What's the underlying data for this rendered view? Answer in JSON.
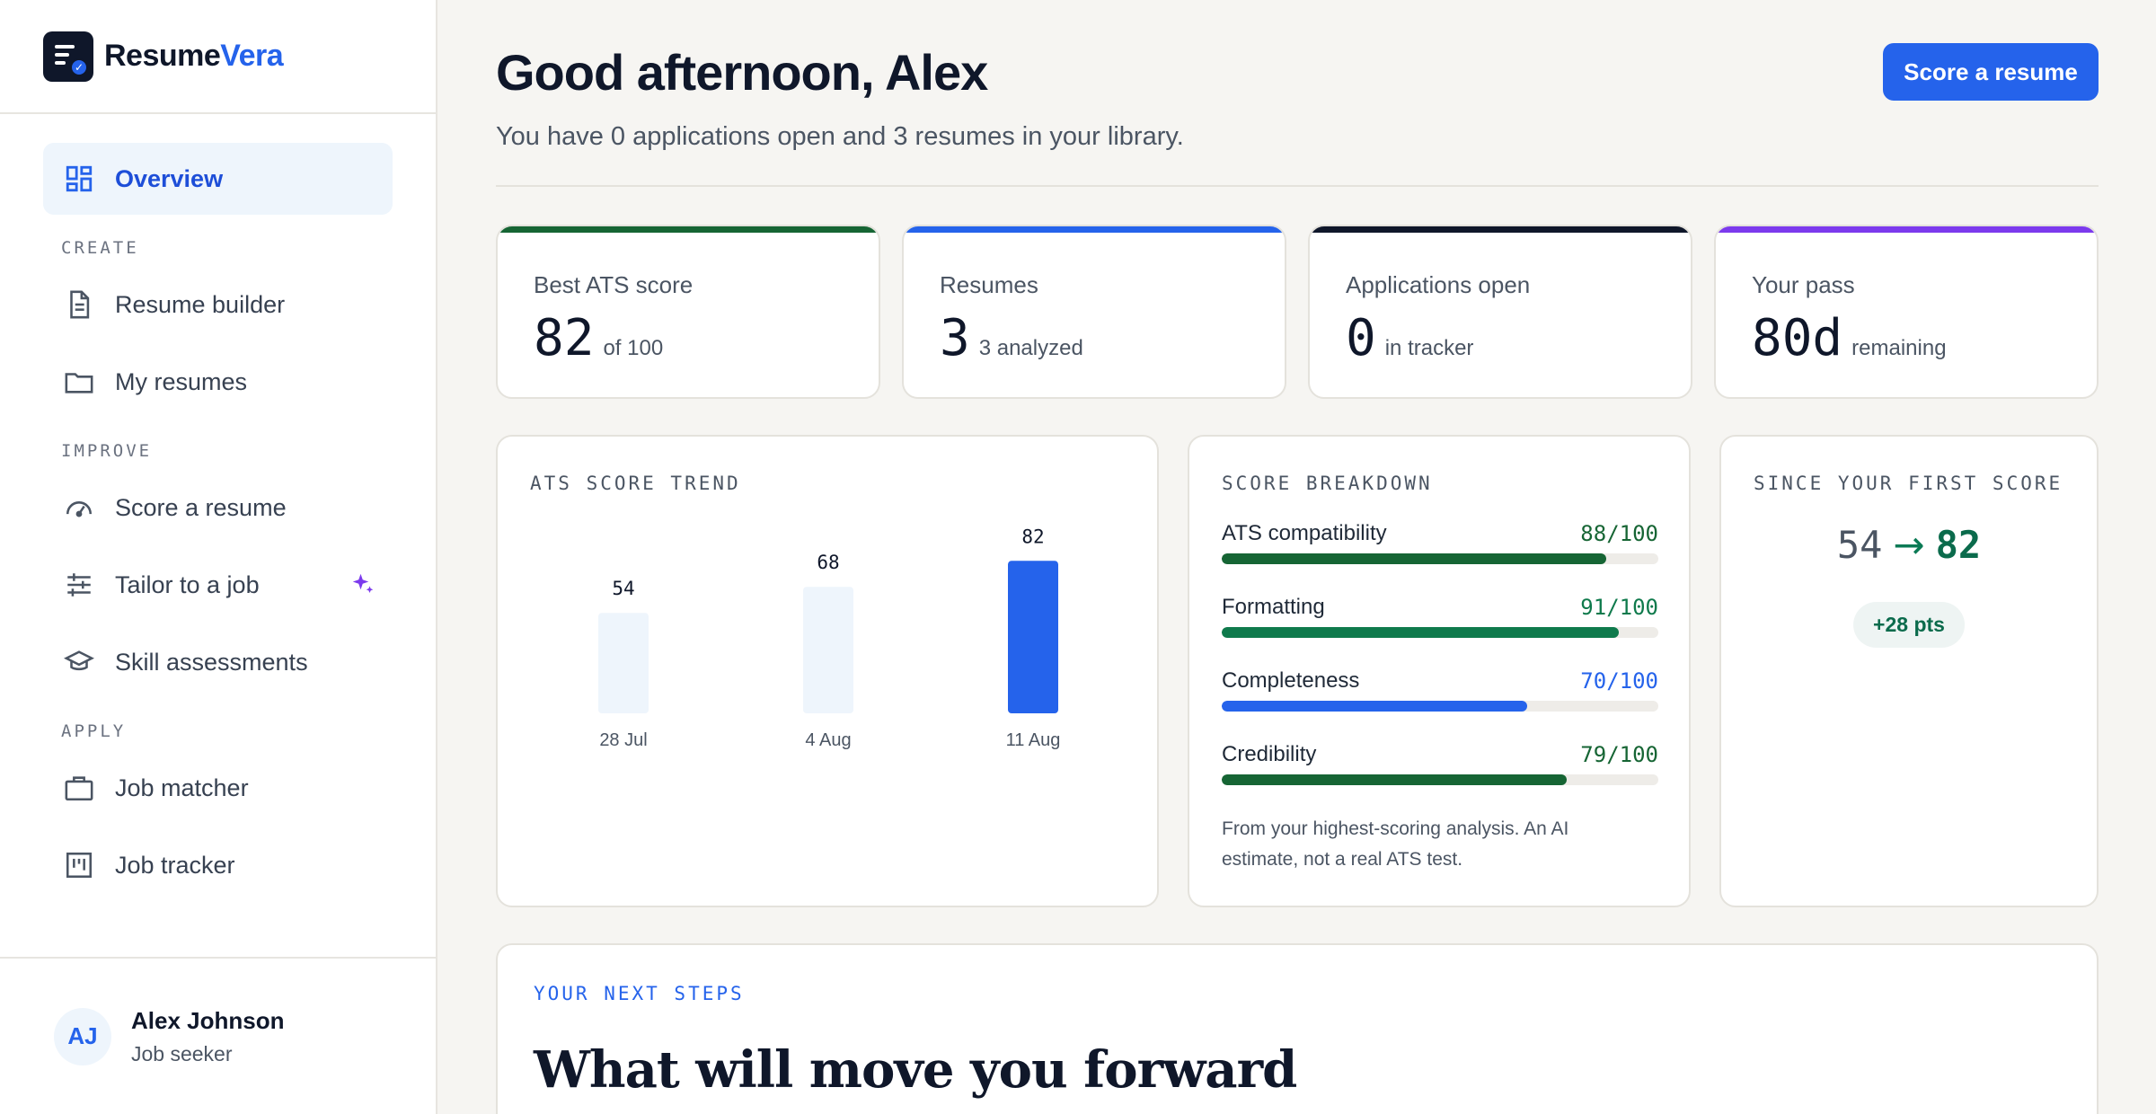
{
  "brand": {
    "name_part1": "Resume",
    "name_part2": "Vera"
  },
  "sidebar": {
    "overview": "Overview",
    "sections": {
      "create": "CREATE",
      "improve": "IMPROVE",
      "apply": "APPLY"
    },
    "items": {
      "resume_builder": "Resume builder",
      "my_resumes": "My resumes",
      "score_resume": "Score a resume",
      "tailor_job": "Tailor to a job",
      "skill_assessments": "Skill assessments",
      "job_matcher": "Job matcher",
      "job_tracker": "Job tracker"
    },
    "user": {
      "initials": "AJ",
      "name": "Alex Johnson",
      "role": "Job seeker"
    }
  },
  "header": {
    "greeting": "Good afternoon, Alex",
    "subtitle": "You have 0 applications open and 3 resumes in your library.",
    "cta": "Score a resume"
  },
  "stats": [
    {
      "label": "Best ATS score",
      "value": "82",
      "unit": "of 100",
      "accent": "#166534"
    },
    {
      "label": "Resumes",
      "value": "3",
      "unit": "3 analyzed",
      "accent": "#2563eb"
    },
    {
      "label": "Applications open",
      "value": "0",
      "unit": "in tracker",
      "accent": "#0f172a"
    },
    {
      "label": "Your pass",
      "value": "80d",
      "unit": "remaining",
      "accent": "#7c3aed"
    }
  ],
  "trend": {
    "title": "ATS SCORE TREND"
  },
  "chart_data": {
    "type": "bar",
    "title": "ATS SCORE TREND",
    "categories": [
      "28 Jul",
      "4 Aug",
      "11 Aug"
    ],
    "values": [
      54,
      68,
      82
    ],
    "highlight_index": 2,
    "colors": {
      "default": "#eef5fc",
      "highlight": "#2563eb"
    }
  },
  "breakdown": {
    "title": "SCORE BREAKDOWN",
    "rows": [
      {
        "label": "ATS compatibility",
        "value": 88,
        "display": "88/100",
        "color": "#166534",
        "value_color": "#166534"
      },
      {
        "label": "Formatting",
        "value": 91,
        "display": "91/100",
        "color": "#0f7a4c",
        "value_color": "#0f7a4c"
      },
      {
        "label": "Completeness",
        "value": 70,
        "display": "70/100",
        "color": "#2563eb",
        "value_color": "#2563eb"
      },
      {
        "label": "Credibility",
        "value": 79,
        "display": "79/100",
        "color": "#166534",
        "value_color": "#166534"
      }
    ],
    "footnote": "From your highest-scoring analysis. An AI estimate, not a real ATS test."
  },
  "since": {
    "title": "SINCE YOUR FIRST SCORE",
    "from": "54",
    "arrow": "→",
    "to": "82",
    "delta": "+28 pts"
  },
  "next_steps": {
    "kicker": "YOUR NEXT STEPS",
    "headline": "What will move you forward"
  }
}
